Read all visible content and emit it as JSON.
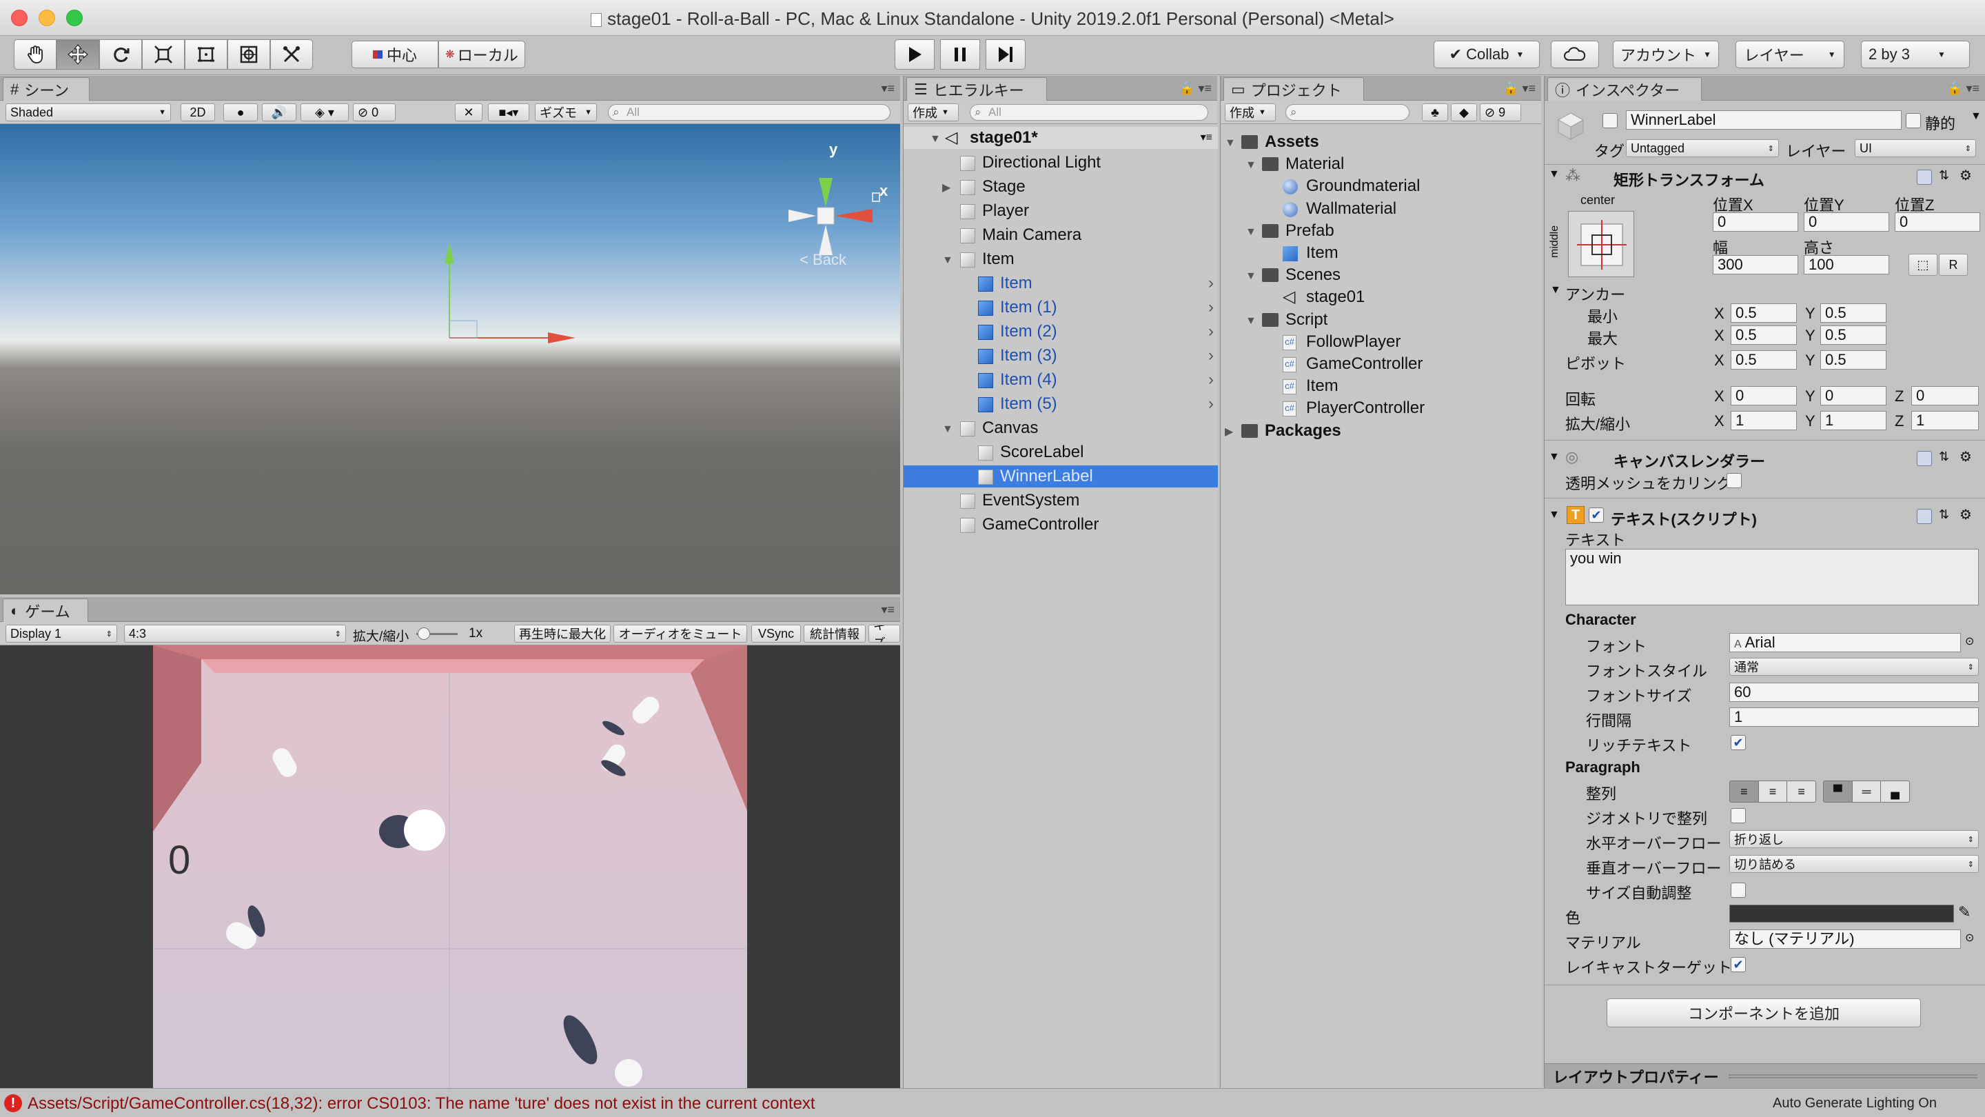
{
  "window": {
    "title": "stage01 - Roll-a-Ball - PC, Mac & Linux Standalone - Unity 2019.2.0f1 Personal (Personal) <Metal>"
  },
  "toolbar": {
    "pivot_label": "中心",
    "space_label": "ローカル",
    "collab_label": "Collab",
    "account_label": "アカウント",
    "layers_label": "レイヤー",
    "layout_label": "2 by 3"
  },
  "scene": {
    "tab_label": "シーン",
    "shading": "Shaded",
    "mode_2d": "2D",
    "hidden_count": "0",
    "gizmos_label": "ギズモ",
    "search_placeholder": "All",
    "back_label": "Back",
    "axis_y": "y",
    "axis_x": "x"
  },
  "game": {
    "tab_label": "ゲーム",
    "display": "Display 1",
    "aspect": "4:3",
    "scale_label": "拡大/縮小",
    "scale_value": "1x",
    "maximize": "再生時に最大化",
    "mute": "オーディオをミュート",
    "vsync": "VSync",
    "stats": "統計情報",
    "gizmos": "ギズ",
    "score": "0"
  },
  "hierarchy": {
    "tab_label": "ヒエラルキー",
    "create_label": "作成",
    "search_placeholder": "All",
    "scene_name": "stage01*",
    "items": [
      {
        "label": "Directional Light",
        "blue": false
      },
      {
        "label": "Stage",
        "blue": false
      },
      {
        "label": "Player",
        "blue": false
      },
      {
        "label": "Main Camera",
        "blue": false
      },
      {
        "label": "Item",
        "blue": false
      },
      {
        "label": "Item",
        "blue": true
      },
      {
        "label": "Item (1)",
        "blue": true
      },
      {
        "label": "Item (2)",
        "blue": true
      },
      {
        "label": "Item (3)",
        "blue": true
      },
      {
        "label": "Item (4)",
        "blue": true
      },
      {
        "label": "Item (5)",
        "blue": true
      },
      {
        "label": "Canvas",
        "blue": false
      },
      {
        "label": "ScoreLabel",
        "blue": false
      },
      {
        "label": "WinnerLabel",
        "blue": false,
        "selected": true
      },
      {
        "label": "EventSystem",
        "blue": false
      },
      {
        "label": "GameController",
        "blue": false
      }
    ]
  },
  "project": {
    "tab_label": "プロジェクト",
    "create_label": "作成",
    "hidden_count": "9",
    "items": [
      {
        "label": "Assets",
        "type": "folder",
        "bold": true
      },
      {
        "label": "Material",
        "type": "folder"
      },
      {
        "label": "Groundmaterial",
        "type": "material"
      },
      {
        "label": "Wallmaterial",
        "type": "material"
      },
      {
        "label": "Prefab",
        "type": "folder"
      },
      {
        "label": "Item",
        "type": "prefab"
      },
      {
        "label": "Scenes",
        "type": "folder"
      },
      {
        "label": "stage01",
        "type": "scene"
      },
      {
        "label": "Script",
        "type": "folder"
      },
      {
        "label": "FollowPlayer",
        "type": "script"
      },
      {
        "label": "GameController",
        "type": "script"
      },
      {
        "label": "Item",
        "type": "script"
      },
      {
        "label": "PlayerController",
        "type": "script"
      },
      {
        "label": "Packages",
        "type": "folder",
        "bold": true
      }
    ]
  },
  "inspector": {
    "tab_label": "インスペクター",
    "object_name": "WinnerLabel",
    "static_label": "静的",
    "tag_label": "タグ",
    "tag_value": "Untagged",
    "layer_label": "レイヤー",
    "layer_value": "UI",
    "rect": {
      "header": "矩形トランスフォーム",
      "anchor_h": "center",
      "anchor_v": "middle",
      "posx_label": "位置X",
      "posy_label": "位置Y",
      "posz_label": "位置Z",
      "posx": "0",
      "posy": "0",
      "posz": "0",
      "width_label": "幅",
      "height_label": "高さ",
      "width": "300",
      "height": "100",
      "r_btn": "R",
      "anchors_label": "アンカー",
      "min_label": "最小",
      "max_label": "最大",
      "min_x": "0.5",
      "min_y": "0.5",
      "max_x": "0.5",
      "max_y": "0.5",
      "pivot_label": "ピボット",
      "pivot_x": "0.5",
      "pivot_y": "0.5",
      "rotation_label": "回転",
      "rot_x": "0",
      "rot_y": "0",
      "rot_z": "0",
      "scale_label": "拡大/縮小",
      "scale_x": "1",
      "scale_y": "1",
      "scale_z": "1",
      "x": "X",
      "y": "Y",
      "z": "Z"
    },
    "canvas_renderer": {
      "header": "キャンバスレンダラー",
      "cull_label": "透明メッシュをカリング"
    },
    "text": {
      "header": "テキスト(スクリプト)",
      "text_label": "テキスト",
      "text_value": "you win",
      "character_label": "Character",
      "font_label": "フォント",
      "font_value": "Arial",
      "style_label": "フォントスタイル",
      "style_value": "通常",
      "size_label": "フォントサイズ",
      "size_value": "60",
      "spacing_label": "行間隔",
      "spacing_value": "1",
      "rich_label": "リッチテキスト",
      "paragraph_label": "Paragraph",
      "align_label": "整列",
      "geometry_label": "ジオメトリで整列",
      "hoverflow_label": "水平オーバーフロー",
      "hoverflow_value": "折り返し",
      "voverflow_label": "垂直オーバーフロー",
      "voverflow_value": "切り詰める",
      "bestfit_label": "サイズ自動調整",
      "color_label": "色",
      "color_value": "#323232",
      "material_label": "マテリアル",
      "material_value": "なし (マテリアル)",
      "raycast_label": "レイキャストターゲット"
    },
    "add_component": "コンポーネントを追加",
    "layout_props": "レイアウトプロパティー"
  },
  "status": {
    "error": "Assets/Script/GameController.cs(18,32): error CS0103: The name 'ture' does not exist in the current context",
    "right": "Auto Generate Lighting On"
  }
}
